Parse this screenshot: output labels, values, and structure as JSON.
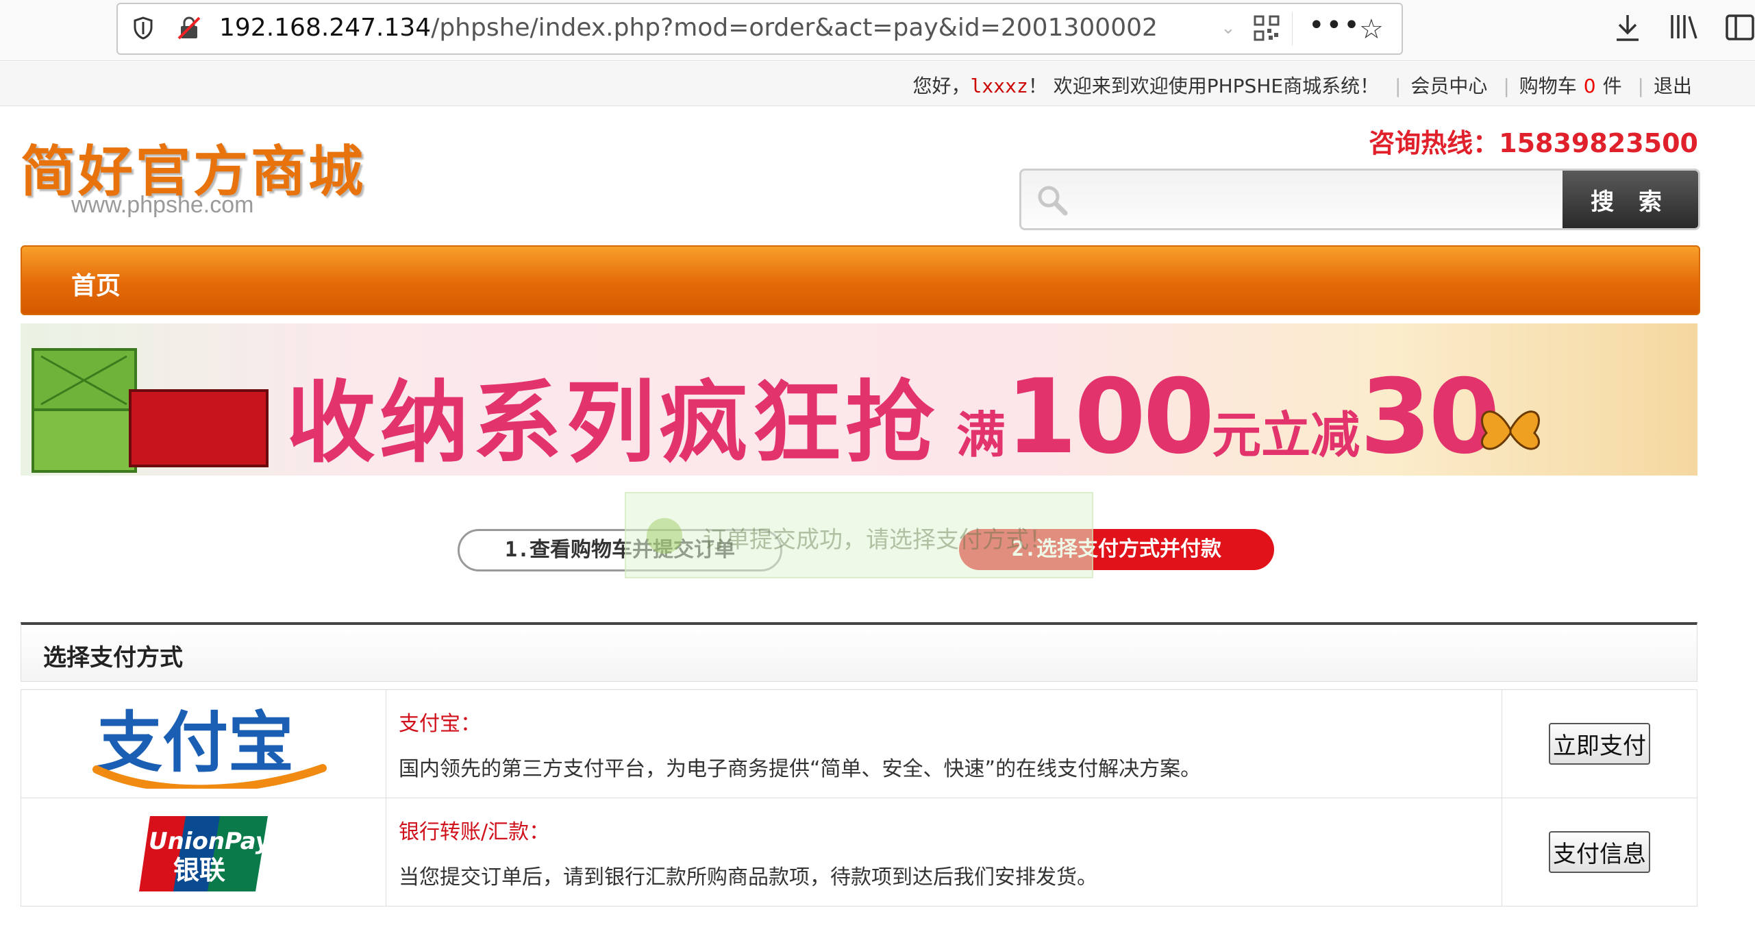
{
  "browser": {
    "url_host": "192.168.247.134",
    "url_path": "/phpshe/index.php?mod=order&act=pay&id=2001300002",
    "more_label": "•••"
  },
  "topbar": {
    "greeting": "您好，",
    "username": "lxxxz",
    "welcome": "！ 欢迎来到欢迎使用PHPSHE商城系统！",
    "member_center": "会员中心",
    "cart_label": "购物车",
    "cart_count": "0",
    "cart_unit": "件",
    "logout": "退出"
  },
  "header": {
    "logo_text": "简好官方商城",
    "logo_url": "www.phpshe.com",
    "hotline": "咨询热线：15839823500",
    "search_button": "搜 索",
    "search_placeholder": ""
  },
  "nav": {
    "items": [
      {
        "label": "首页"
      }
    ]
  },
  "banner": {
    "title": "收纳系列疯狂抢",
    "promo_prefix": "满",
    "promo_amount": "100",
    "promo_mid": "元立减",
    "promo_discount": "30"
  },
  "steps": [
    {
      "label": "1.查看购物车并提交订单"
    },
    {
      "label": "2.选择支付方式并付款"
    }
  ],
  "toast": {
    "message": "订单提交成功，请选择支付方式！"
  },
  "payment": {
    "title": "选择支付方式",
    "methods": [
      {
        "name": "支付宝：",
        "desc": "国内领先的第三方支付平台，为电子商务提供“简单、安全、快速”的在线支付解决方案。",
        "button": "立即支付",
        "logo": "alipay-logo",
        "logo_text": "支付宝"
      },
      {
        "name": "银行转账/汇款：",
        "desc": "当您提交订单后，请到银行汇款所购商品款项，待款项到达后我们安排发货。",
        "button": "支付信息",
        "logo": "unionpay-logo",
        "logo_text": "UnionPay 银联"
      }
    ]
  },
  "colors": {
    "accent": "#e46a08",
    "hotline": "#e0202a",
    "step_active": "#e2121a"
  }
}
